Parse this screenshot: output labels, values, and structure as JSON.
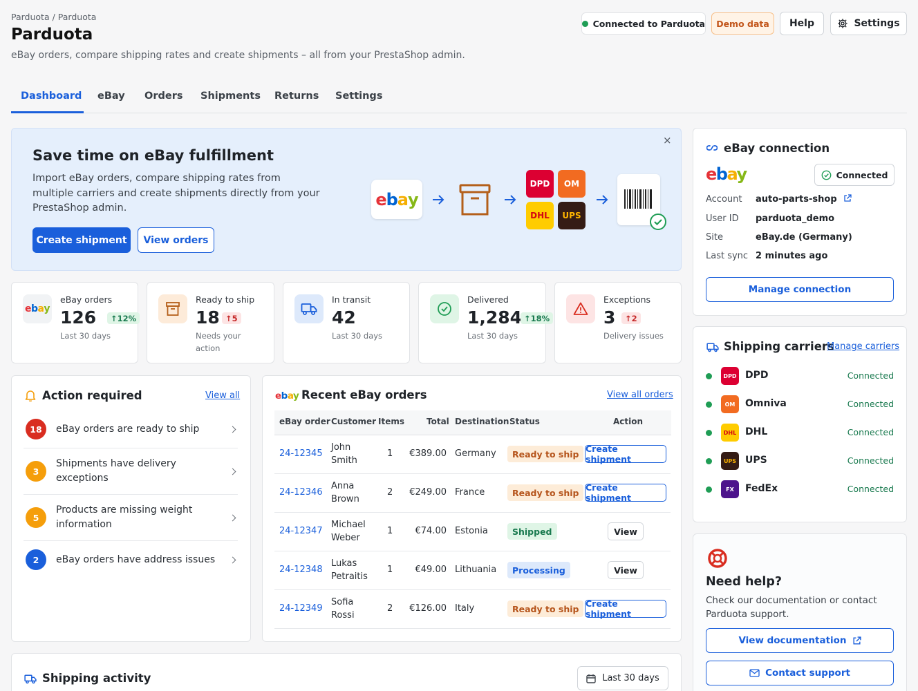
{
  "header": {
    "breadcrumb": "Parduota / Parduota",
    "title": "Parduota",
    "subtitle": "eBay orders, compare shipping rates and create shipments – all from your PrestaShop admin.",
    "connection_status": "Connected to Parduota",
    "demo_badge": "Demo data",
    "help_label": "Help",
    "settings_label": "Settings"
  },
  "tabs": [
    {
      "label": "Dashboard",
      "active": true
    },
    {
      "label": "eBay"
    },
    {
      "label": "Orders"
    },
    {
      "label": "Shipments"
    },
    {
      "label": "Returns"
    },
    {
      "label": "Settings"
    }
  ],
  "hero": {
    "title": "Save time on eBay fulfillment",
    "text": "Import eBay orders, compare shipping rates from multiple carriers and create shipments directly from your PrestaShop admin.",
    "primary_label": "Create shipment",
    "secondary_label": "View orders",
    "close": "×",
    "illustration": {
      "ebay_logo": [
        "e",
        "b",
        "a",
        "y"
      ],
      "carriers": [
        "DPD",
        "OM",
        "DHL",
        "UPS"
      ]
    }
  },
  "kpis": [
    {
      "label": "eBay orders",
      "value": "126",
      "delta": "12%",
      "trend": "up-good",
      "sub": "Last 30 days",
      "icon": "ebay-logo-icon"
    },
    {
      "label": "Ready to ship",
      "value": "18",
      "delta": "5",
      "trend": "up-bad",
      "sub": "Needs your action",
      "icon": "archive-box-icon"
    },
    {
      "label": "In transit",
      "value": "42",
      "delta": "",
      "sub": "Last 30 days",
      "icon": "truck-icon"
    },
    {
      "label": "Delivered",
      "value": "1,284",
      "delta": "18%",
      "trend": "up-good",
      "sub": "Last 30 days",
      "icon": "check-circle-icon"
    },
    {
      "label": "Exceptions",
      "value": "3",
      "delta": "2",
      "trend": "up-bad",
      "sub": "Delivery issues",
      "icon": "warning-triangle-icon"
    }
  ],
  "action_required": {
    "title": "Action required",
    "view_all": "View all",
    "items": [
      {
        "count": "18",
        "text": "eBay orders are ready to ship",
        "color": "#d92d20"
      },
      {
        "count": "3",
        "text": "Shipments have delivery exceptions",
        "color": "#f59e0b"
      },
      {
        "count": "5",
        "text": "Products are missing weight information",
        "color": "#f59e0b"
      },
      {
        "count": "2",
        "text": "eBay orders have address issues",
        "color": "#1a5fdb"
      }
    ]
  },
  "recent_orders": {
    "title": "Recent eBay orders",
    "view_all": "View all orders",
    "columns": [
      "eBay order",
      "Customer",
      "Items",
      "Total",
      "Destination",
      "Status",
      "Action"
    ],
    "rows": [
      {
        "order": "24-12345",
        "customer_first": "John",
        "customer_last": "Smith",
        "items": "1",
        "total": "€389.00",
        "destination": "Germany",
        "status": "Ready to ship",
        "status_kind": "ready",
        "action": "Create shipment"
      },
      {
        "order": "24-12346",
        "customer_first": "Anna",
        "customer_last": "Brown",
        "items": "2",
        "total": "€249.00",
        "destination": "France",
        "status": "Ready to ship",
        "status_kind": "ready",
        "action": "Create shipment"
      },
      {
        "order": "24-12347",
        "customer_first": "Michael",
        "customer_last": "Weber",
        "items": "1",
        "total": "€74.00",
        "destination": "Estonia",
        "status": "Shipped",
        "status_kind": "shipped",
        "action": "View"
      },
      {
        "order": "24-12348",
        "customer_first": "Lukas",
        "customer_last": "Petraitis",
        "items": "1",
        "total": "€49.00",
        "destination": "Lithuania",
        "status": "Processing",
        "status_kind": "processing",
        "action": "View"
      },
      {
        "order": "24-12349",
        "customer_first": "Sofia",
        "customer_last": "Rossi",
        "items": "2",
        "total": "€126.00",
        "destination": "Italy",
        "status": "Ready to ship",
        "status_kind": "ready",
        "action": "Create shipment"
      }
    ]
  },
  "shipping_activity": {
    "title": "Shipping activity",
    "range": "Last 30 days"
  },
  "ebay_connection": {
    "title": "eBay connection",
    "status": "Connected",
    "account_label": "Account",
    "account": "auto-parts-shop",
    "user_label": "User ID",
    "user": "parduota_demo",
    "site_label": "Site",
    "site": "eBay.de (Germany)",
    "sync_label": "Last sync",
    "sync": "2 minutes ago",
    "manage_label": "Manage connection"
  },
  "carriers": {
    "title": "Shipping carriers",
    "manage": "Manage carriers",
    "items": [
      {
        "name": "DPD",
        "logo": "DPD",
        "status": "Connected",
        "bg": "#dc0032",
        "fg": "#ffffff"
      },
      {
        "name": "Omniva",
        "logo": "OM",
        "status": "Connected",
        "bg": "#f26b21",
        "fg": "#ffffff"
      },
      {
        "name": "DHL",
        "logo": "DHL",
        "status": "Connected",
        "bg": "#ffcc00",
        "fg": "#d40511"
      },
      {
        "name": "UPS",
        "logo": "UPS",
        "status": "Connected",
        "bg": "#351c15",
        "fg": "#ffb500"
      },
      {
        "name": "FedEx",
        "logo": "FX",
        "status": "Connected",
        "bg": "#4d148c",
        "fg": "#ffffff"
      }
    ]
  },
  "help": {
    "title": "Need help?",
    "text": "Check our documentation or contact Parduota support.",
    "docs_label": "View documentation",
    "support_label": "Contact support"
  },
  "colors": {
    "accent": "#1a5fdb",
    "success": "#1f9d55",
    "warning": "#f59e0b",
    "danger": "#d92d20"
  }
}
